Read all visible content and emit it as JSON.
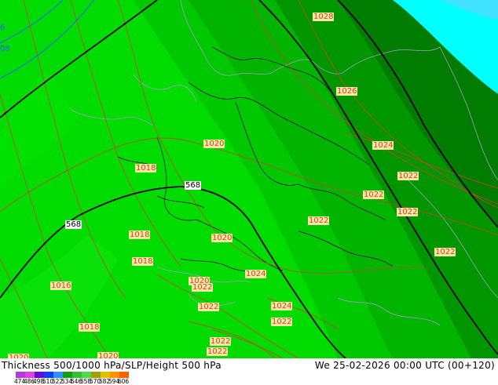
{
  "title": "Thickness 500/1000 hPa/SLP/Height 500 hPa",
  "valid_time": "We 25-02-2026 00:00 UTC (00+120)",
  "legend": {
    "values": [
      "474",
      "486",
      "498",
      "510",
      "522",
      "534",
      "546",
      "558",
      "570",
      "582",
      "594",
      "606"
    ],
    "colors": [
      "#b23cd8",
      "#e040e0",
      "#6010d0",
      "#1040f0",
      "#3090ff",
      "#10a010",
      "#30c030",
      "#50d850",
      "#a0a000",
      "#e0c000",
      "#ff9000",
      "#ff6000"
    ]
  },
  "pressure_labels": [
    "1028",
    "1026",
    "1024",
    "1022",
    "1022",
    "1022",
    "1022",
    "1022",
    "1020",
    "1020",
    "1018",
    "1018",
    "1018",
    "1016",
    "1018",
    "1020",
    "1020",
    "1022",
    "1022",
    "1024",
    "1024",
    "1022",
    "1022",
    "1022",
    "1020"
  ],
  "height_labels": [
    "568",
    "568"
  ],
  "edge_labels": [
    "6",
    "08"
  ],
  "colors": {
    "band_546": "#00c800",
    "band_552": "#00b400",
    "band_558": "#009600",
    "band_564": "#007d00",
    "band_cold": "#00ffff",
    "isobar": "#d04030",
    "height_line": "#000000",
    "border": "#000000",
    "coast": "#a0a0c0",
    "label_bg": "#f6e8a0"
  }
}
